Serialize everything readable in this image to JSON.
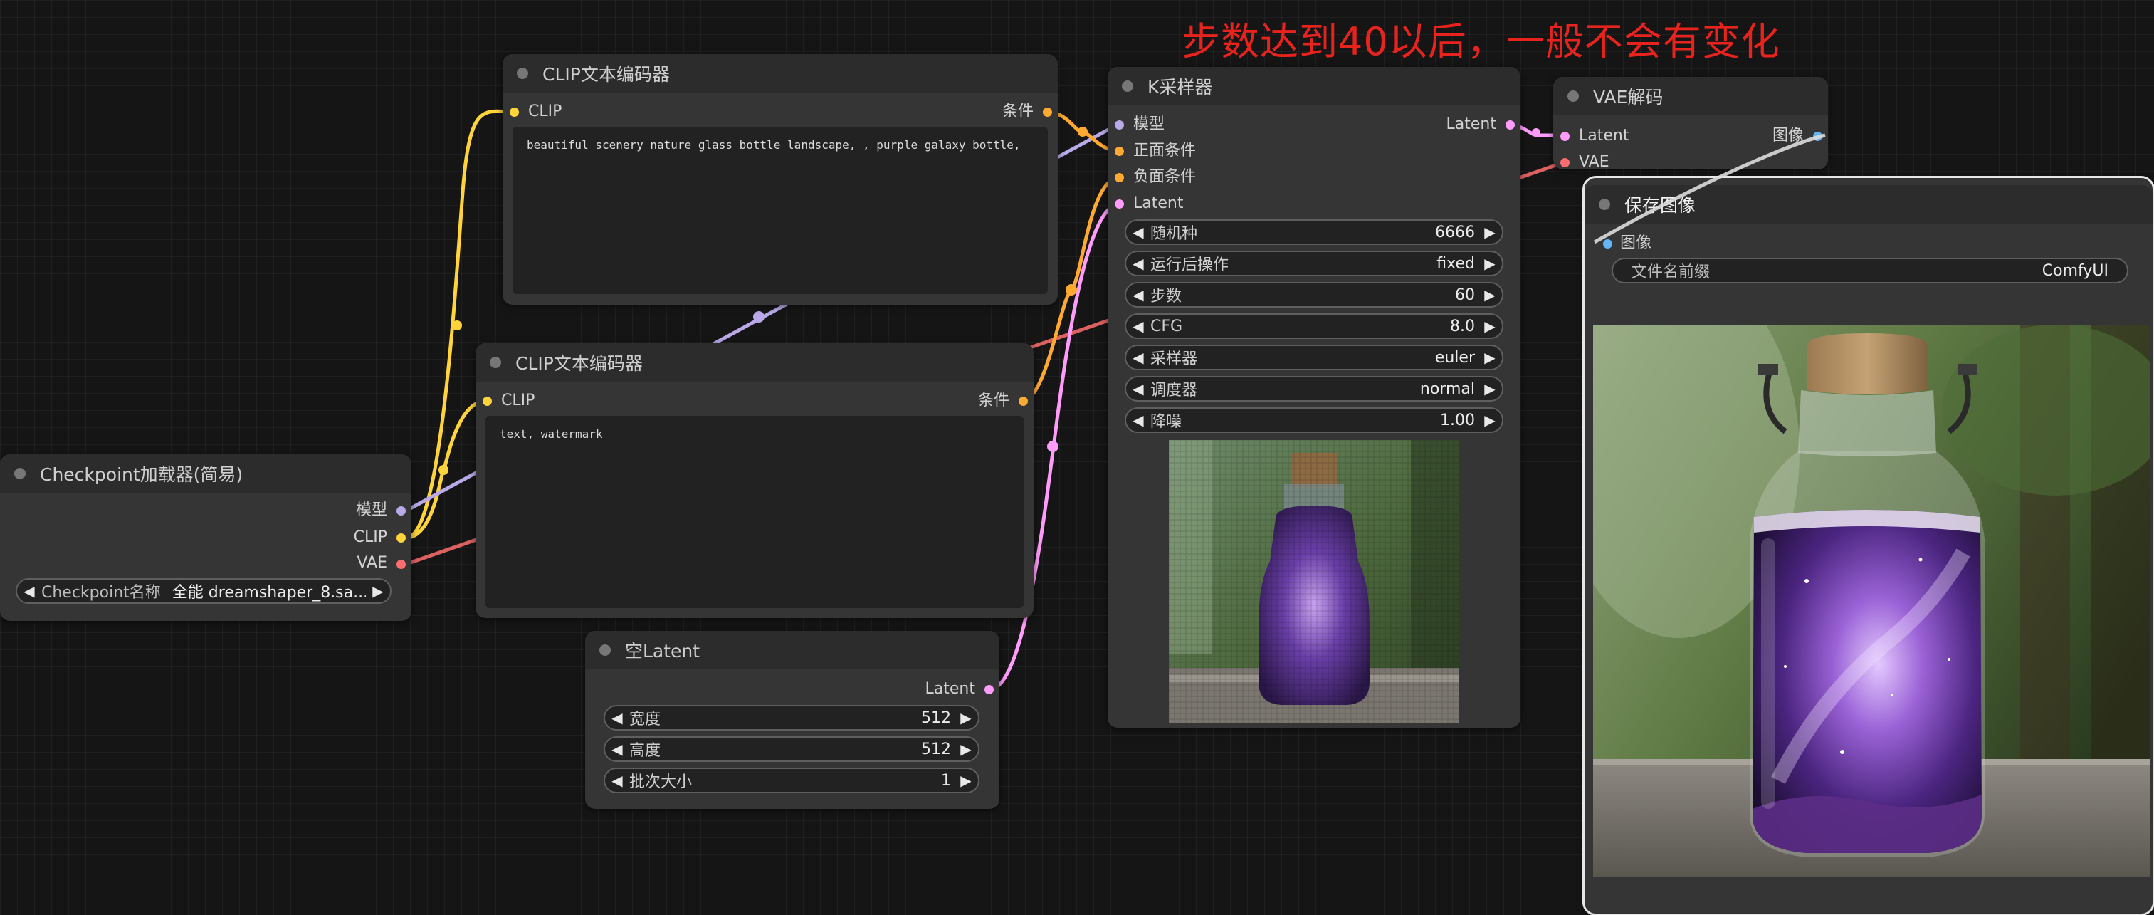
{
  "annotation": "步数达到40以后，一般不会有变化",
  "colors": {
    "clip": "#ffd43b",
    "model": "#b9a9e8",
    "vae": "#ff6e6e",
    "conditioning": "#ffa931",
    "latent": "#ff9cf9",
    "image": "#64b5f6"
  },
  "clip_pos": {
    "title": "CLIP文本编码器",
    "input_clip": "CLIP",
    "output": "条件",
    "text": "beautiful scenery nature glass bottle landscape, , purple galaxy bottle,"
  },
  "clip_neg": {
    "title": "CLIP文本编码器",
    "input_clip": "CLIP",
    "output": "条件",
    "text": "text, watermark"
  },
  "checkpoint": {
    "title": "Checkpoint加载器(简易)",
    "outputs": [
      "模型",
      "CLIP",
      "VAE"
    ],
    "widget_label": "Checkpoint名称",
    "widget_value": "全能 dreamshaper_8.sa..."
  },
  "empty_latent": {
    "title": "空Latent",
    "output": "Latent",
    "widgets": [
      {
        "label": "宽度",
        "value": "512"
      },
      {
        "label": "高度",
        "value": "512"
      },
      {
        "label": "批次大小",
        "value": "1"
      }
    ]
  },
  "ksampler": {
    "title": "K采样器",
    "output": "Latent",
    "inputs": [
      "模型",
      "正面条件",
      "负面条件",
      "Latent"
    ],
    "widgets": [
      {
        "label": "随机种",
        "value": "6666"
      },
      {
        "label": "运行后操作",
        "value": "fixed"
      },
      {
        "label": "步数",
        "value": "60"
      },
      {
        "label": "CFG",
        "value": "8.0"
      },
      {
        "label": "采样器",
        "value": "euler"
      },
      {
        "label": "调度器",
        "value": "normal"
      },
      {
        "label": "降噪",
        "value": "1.00"
      }
    ]
  },
  "vae_decode": {
    "title": "VAE解码",
    "inputs": [
      "Latent",
      "VAE"
    ],
    "output": "图像"
  },
  "save_image": {
    "title": "保存图像",
    "input": "图像",
    "widget_label": "文件名前缀",
    "widget_value": "ComfyUI"
  }
}
